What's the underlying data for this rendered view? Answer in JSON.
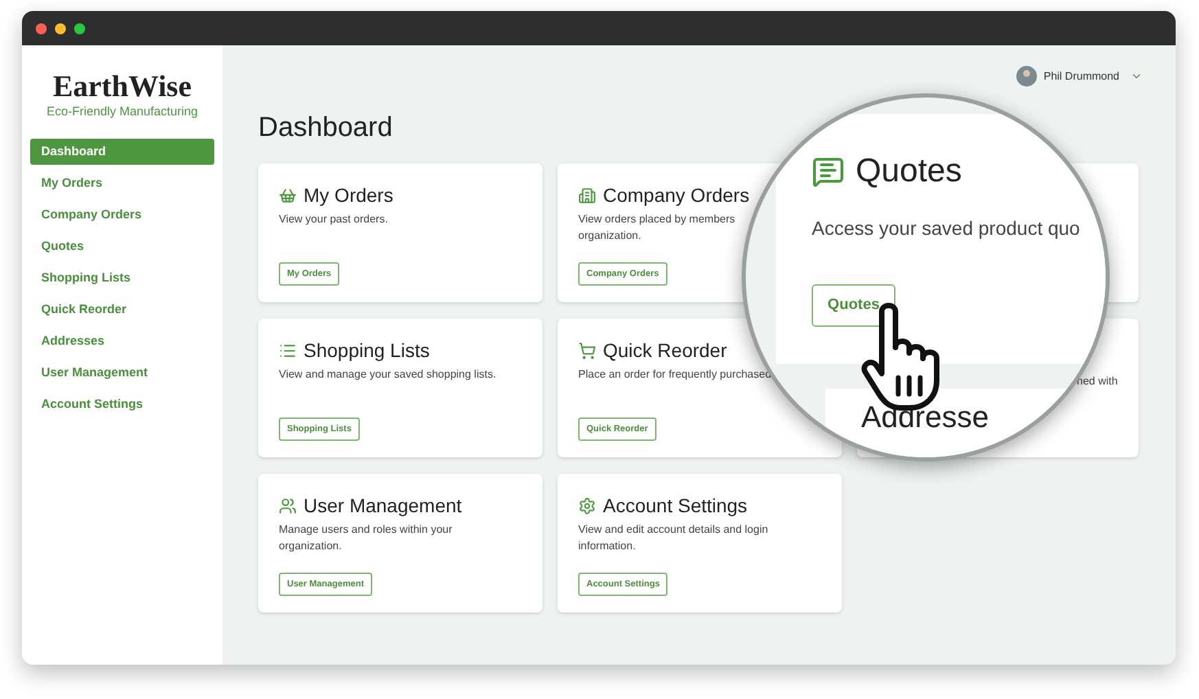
{
  "sidebar": {
    "logo": "EarthWise",
    "tagline": "Eco-Friendly Manufacturing",
    "items": [
      {
        "label": "Dashboard",
        "selected": true
      },
      {
        "label": "My Orders",
        "selected": false
      },
      {
        "label": "Company Orders",
        "selected": false
      },
      {
        "label": "Quotes",
        "selected": false
      },
      {
        "label": "Shopping Lists",
        "selected": false
      },
      {
        "label": "Quick Reorder",
        "selected": false
      },
      {
        "label": "Addresses",
        "selected": false
      },
      {
        "label": "User Management",
        "selected": false
      },
      {
        "label": "Account Settings",
        "selected": false
      }
    ]
  },
  "user": {
    "name": "Phil Drummond"
  },
  "page_title": "Dashboard",
  "cards": [
    {
      "kind": "card",
      "title": "My Orders",
      "description_lines": [
        "View your past orders."
      ],
      "button": "My Orders"
    },
    {
      "kind": "card",
      "title": "Company Orders",
      "description_lines": [
        "View orders placed by members",
        "organization."
      ],
      "button": "Company Orders"
    },
    {
      "kind": "covered"
    },
    {
      "kind": "card",
      "title": "Shopping Lists",
      "description_lines": [
        "View and manage your saved shopping lists."
      ],
      "button": "Shopping Lists"
    },
    {
      "kind": "card",
      "title": "Quick Reorder",
      "description_lines": [
        "Place an order for frequently purchased"
      ],
      "button": "Quick Reorder"
    },
    {
      "kind": "covered",
      "fragment": "ned with"
    },
    {
      "kind": "card",
      "title": "User Management",
      "description_lines": [
        "Manage users and roles within your",
        "organization."
      ],
      "button": "User Management"
    },
    {
      "kind": "card",
      "title": "Account Settings",
      "description_lines": [
        "View and edit account details and login",
        "information."
      ],
      "button": "Account Settings"
    }
  ],
  "magnifier": {
    "title": "Quotes",
    "description": "Access your saved product quo",
    "button": "Quotes",
    "next_title": "Addresse"
  }
}
